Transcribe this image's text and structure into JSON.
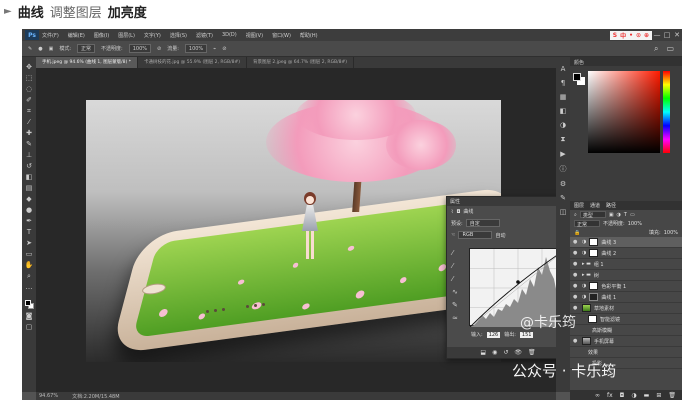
{
  "heading": {
    "bullet": "►",
    "part1": "曲线",
    "part2": "调整图层",
    "part3": "加亮度"
  },
  "menubar": {
    "logo": "Ps",
    "items": [
      "文件(F)",
      "编辑(E)",
      "图像(I)",
      "图层(L)",
      "文字(Y)",
      "选择(S)",
      "滤镜(T)",
      "3D(D)",
      "视图(V)",
      "窗口(W)",
      "帮助(H)"
    ],
    "ime": [
      "S",
      "中",
      "•",
      "⊙",
      "⊕"
    ],
    "win_buttons": [
      "—",
      "□",
      "✕"
    ]
  },
  "optbar": {
    "mode_label": "模式:",
    "mode_value": "正常",
    "opacity_label": "不透明度:",
    "opacity_value": "100%",
    "flow_label": "流量:",
    "flow_value": "100%"
  },
  "tabs": [
    {
      "label": "手机.jpeg @ 94.6% (曲线 1, 图层蒙版/8) *",
      "active": true
    },
    {
      "label": "卡通树枝的花.jpg @ 55.9% (图层 2, RGB/8#)",
      "active": false
    },
    {
      "label": "背景图层 2.jpeg @ 64.7% (图层 2, RGB/8#)",
      "active": false
    }
  ],
  "curves": {
    "title": "属性",
    "tab": "曲线",
    "preset_label": "预设:",
    "preset_value": "自定",
    "channel_value": "RGB",
    "auto_label": "自动",
    "input_label": "输入:",
    "input_value": "126",
    "output_label": "输出:",
    "output_value": "151"
  },
  "color_panel": {
    "title": "颜色"
  },
  "layers": {
    "tabs": [
      "图层",
      "通道",
      "路径"
    ],
    "kind_label": "类型",
    "blend_value": "正常",
    "opacity_label": "不透明度:",
    "opacity_value": "100%",
    "fill_label": "填充:",
    "fill_value": "100%",
    "items": [
      {
        "name": "曲线 3",
        "type": "adjust",
        "active": true
      },
      {
        "name": "曲线 2",
        "type": "adjust",
        "active": false
      },
      {
        "name": "组 1",
        "type": "group",
        "active": false
      },
      {
        "name": "树",
        "type": "group",
        "active": false
      },
      {
        "name": "色彩平衡 1",
        "type": "adjust",
        "active": false
      },
      {
        "name": "曲线 1",
        "type": "adjust-dark",
        "active": false
      },
      {
        "name": "草地素材",
        "type": "photo",
        "active": false
      },
      {
        "name": "智能滤镜",
        "type": "sub",
        "active": false
      },
      {
        "name": "高斯模糊",
        "type": "sub",
        "active": false
      },
      {
        "name": "手机屏幕",
        "type": "photo",
        "active": false
      },
      {
        "name": "效果",
        "type": "sub",
        "active": false
      },
      {
        "name": "投影",
        "type": "sub",
        "active": false
      }
    ]
  },
  "status": {
    "zoom": "94.67%",
    "doc": "文档:2.20M/15.48M"
  },
  "watermark": {
    "line1": "@卡乐筠",
    "line2": "公众号 · 卡乐筠"
  }
}
